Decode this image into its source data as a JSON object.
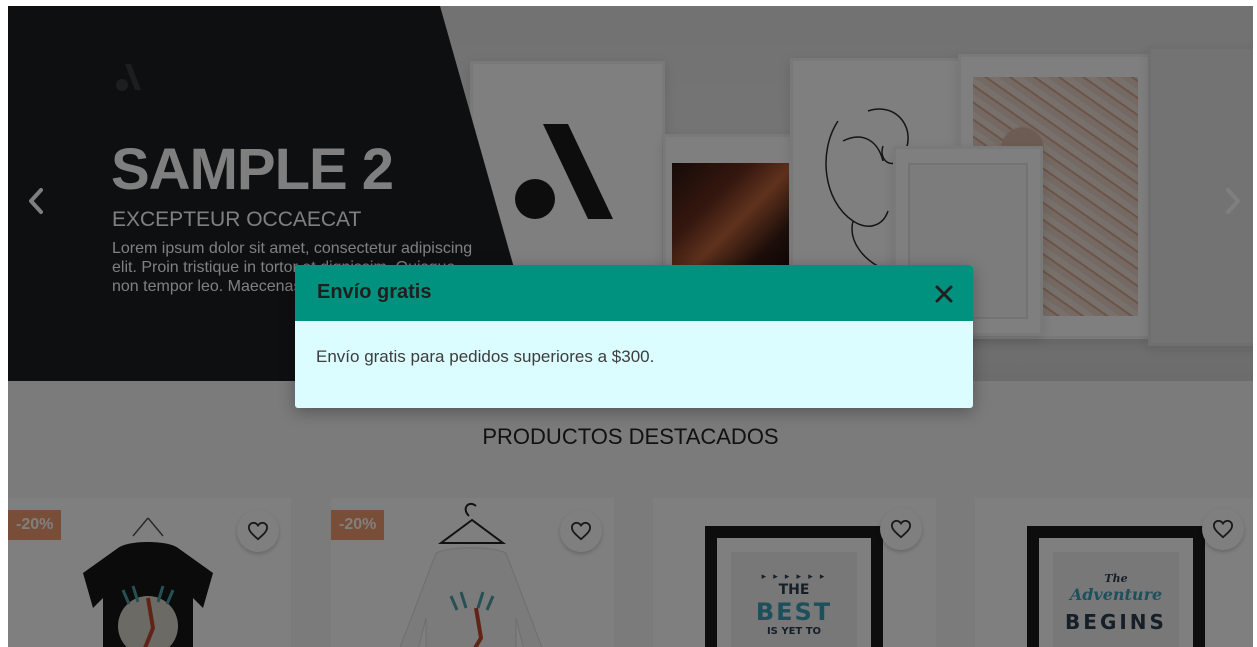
{
  "hero": {
    "title": "SAMPLE 2",
    "subtitle": "EXCEPTEUR OCCAECAT",
    "text": "Lorem ipsum dolor sit amet, consectetur adipiscing elit. Proin tristique in tortor et dignissim. Quisque non tempor leo. Maecenas egestas sem elit",
    "prev_icon": "chevron-left-icon",
    "next_icon": "chevron-right-icon"
  },
  "section": {
    "title": "PRODUCTOS DESTACADOS"
  },
  "products": [
    {
      "discount": "-20%",
      "image": "black-t-shirt",
      "wishlist_icon": "heart-icon"
    },
    {
      "discount": "-20%",
      "image": "white-sweater",
      "wishlist_icon": "heart-icon"
    },
    {
      "poster": [
        "▸ ▸ ▸ ▸ ▸ ▸",
        "THE",
        "BEST",
        "IS YET TO"
      ],
      "image": "best-is-yet-to-come-poster",
      "wishlist_icon": "heart-icon"
    },
    {
      "poster": [
        "The",
        "Adventure",
        "BEGINS"
      ],
      "image": "adventure-begins-poster",
      "wishlist_icon": "heart-icon"
    }
  ],
  "modal": {
    "title": "Envío gratis",
    "message": "Envío gratis para pedidos superiores a $300.",
    "close_icon": "close-icon",
    "header_color": "#00927e",
    "body_color": "#dbfdff"
  },
  "colors": {
    "discount_badge": "#f39d72",
    "overlay": "rgba(0,0,0,0.5)"
  }
}
